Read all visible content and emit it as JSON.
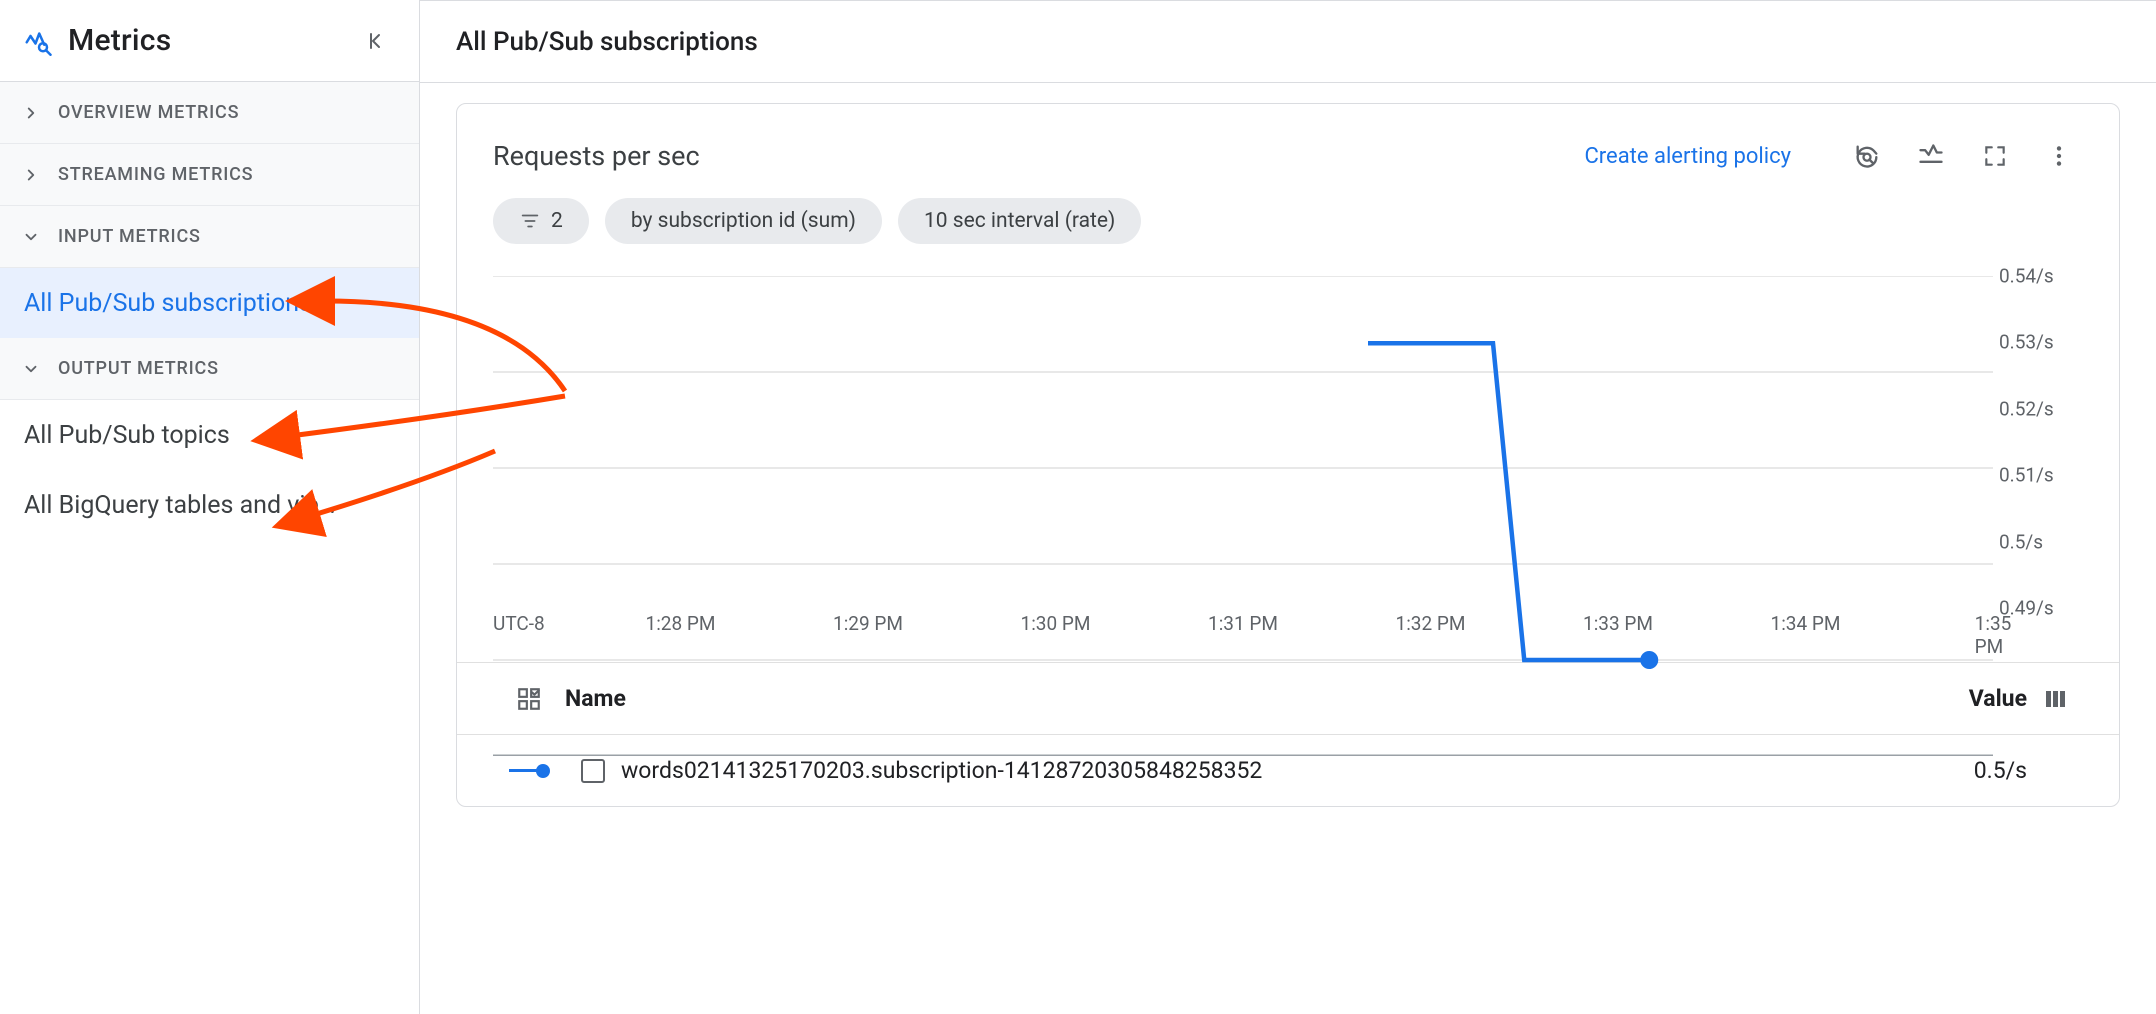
{
  "sidebar": {
    "title": "Metrics",
    "groups": [
      {
        "label": "OVERVIEW METRICS",
        "expanded": false,
        "items": []
      },
      {
        "label": "STREAMING METRICS",
        "expanded": false,
        "items": []
      },
      {
        "label": "INPUT METRICS",
        "expanded": true,
        "items": [
          {
            "label": "All Pub/Sub subscriptions",
            "selected": true
          }
        ]
      },
      {
        "label": "OUTPUT METRICS",
        "expanded": true,
        "items": [
          {
            "label": "All Pub/Sub topics",
            "selected": false
          },
          {
            "label": "All BigQuery tables and vie…",
            "selected": false
          }
        ]
      }
    ]
  },
  "main": {
    "breadcrumb": "All Pub/Sub subscriptions",
    "card": {
      "title": "Requests per sec",
      "create_alert_label": "Create alerting policy",
      "chips": {
        "filter_count": "2",
        "groupby": "by subscription id (sum)",
        "interval": "10 sec interval (rate)"
      },
      "legend_header_name": "Name",
      "legend_header_value": "Value",
      "legend_rows": [
        {
          "name": "words02141325170203.subscription-14128720305848258352",
          "value": "0.5/s",
          "color": "#1a73e8"
        }
      ]
    }
  },
  "chart_data": {
    "type": "line",
    "title": "Requests per sec",
    "xlabel": "UTC-8",
    "ylabel": "",
    "ylim": [
      0.49,
      0.54
    ],
    "y_ticks": [
      "0.54/s",
      "0.53/s",
      "0.52/s",
      "0.51/s",
      "0.5/s",
      "0.49/s"
    ],
    "x_ticks": [
      "UTC-8",
      "1:28 PM",
      "1:29 PM",
      "1:30 PM",
      "1:31 PM",
      "1:32 PM",
      "1:33 PM",
      "1:34 PM",
      "1:35 PM"
    ],
    "series": [
      {
        "name": "words02141325170203.subscription-14128720305848258352",
        "color": "#1a73e8",
        "points": [
          {
            "x": "1:31:40 PM",
            "y": 0.533
          },
          {
            "x": "1:32:20 PM",
            "y": 0.533
          },
          {
            "x": "1:32:30 PM",
            "y": 0.5
          },
          {
            "x": "1:33:10 PM",
            "y": 0.5
          }
        ]
      }
    ]
  }
}
